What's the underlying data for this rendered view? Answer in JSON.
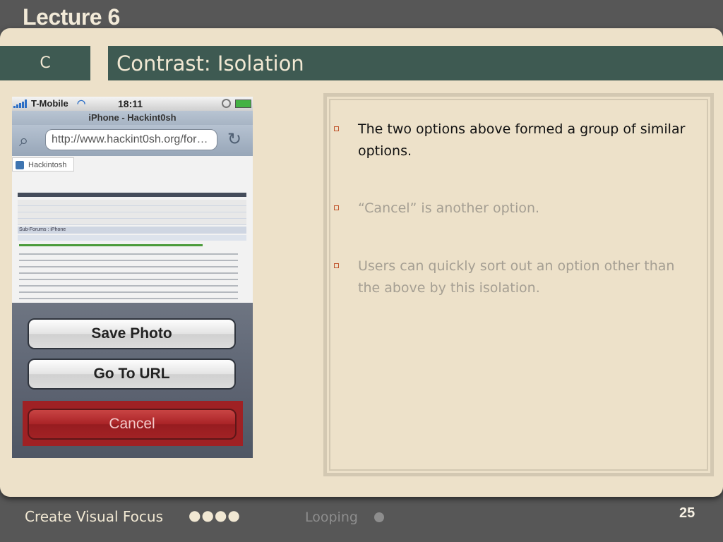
{
  "slide": {
    "lecture_title": "Lecture 6",
    "section_letter": "C",
    "title": "Contrast: Isolation",
    "page_number": "25"
  },
  "phone": {
    "carrier": "T-Mobile",
    "time": "18:11",
    "page_title": "iPhone - Hackint0sh",
    "url": "http://www.hackint0sh.org/foru...",
    "site_logo": "Hackintosh",
    "subforums_label": "Sub-Forums : iPhone",
    "action_sheet": {
      "save_photo": "Save Photo",
      "go_to_url": "Go To URL",
      "cancel": "Cancel"
    }
  },
  "bullets": [
    "The two options above formed a group of similar options.",
    "“Cancel” is another option.",
    "Users can quickly sort out an option other than the above by this isolation."
  ],
  "footer": {
    "current_topic": "Create Visual Focus",
    "current_dots": "●●●●",
    "next_topic": "Looping"
  },
  "colors": {
    "background": "#575757",
    "panel": "#ede1c9",
    "title_bar": "#3e5a52",
    "cancel_highlight": "#9e1b1f"
  }
}
